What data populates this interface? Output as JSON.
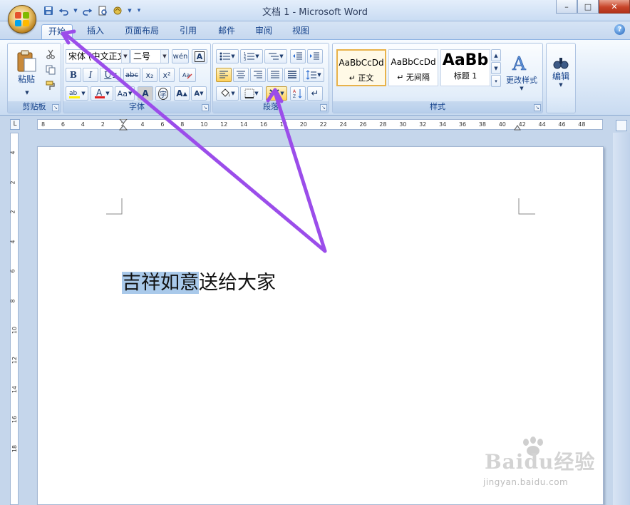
{
  "window": {
    "title": "文档 1 - Microsoft Word",
    "minimize": "–",
    "maximize": "□",
    "close": "✕"
  },
  "qat": {
    "save_icon": "save-icon",
    "undo_icon": "undo-icon",
    "redo_icon": "redo-icon",
    "print_preview_icon": "print-preview-icon",
    "customize_icon": "customize-qat-icon"
  },
  "tabs": [
    "开始",
    "插入",
    "页面布局",
    "引用",
    "邮件",
    "审阅",
    "视图"
  ],
  "active_tab": "开始",
  "help_label": "?",
  "ribbon": {
    "clipboard": {
      "label": "剪贴板",
      "paste": "粘贴"
    },
    "font": {
      "label": "字体",
      "font_name": "宋体 (中文正文)",
      "font_size": "二号",
      "bold": "B",
      "italic": "I",
      "underline": "U",
      "strike": "abc",
      "subscript": "x₂",
      "superscript": "x²",
      "change_case": "Aa",
      "char_shading": "A",
      "enclose": "字",
      "grow": "A",
      "wen": "wén",
      "border_a": "A"
    },
    "paragraph": {
      "label": "段落"
    },
    "styles": {
      "label": "样式",
      "items": [
        {
          "sample": "AaBbCcDd",
          "name": "↵ 正文"
        },
        {
          "sample": "AaBbCcDd",
          "name": "↵ 无间隔"
        },
        {
          "sample": "AaBb",
          "name": "标题 1"
        }
      ],
      "change_styles": "更改样式"
    },
    "editing": {
      "label": "编辑"
    }
  },
  "ruler": {
    "corner": "L",
    "h_ticks": [
      "8",
      "6",
      "4",
      "2",
      "2",
      "4",
      "6",
      "8",
      "10",
      "12",
      "14",
      "16",
      "18",
      "20",
      "22",
      "24",
      "26",
      "28",
      "30",
      "32",
      "34",
      "36",
      "38",
      "40",
      "42",
      "44",
      "46",
      "48"
    ],
    "v_ticks": [
      "4",
      "2",
      "2",
      "4",
      "6",
      "8",
      "10",
      "12",
      "14",
      "16",
      "18"
    ]
  },
  "document": {
    "selected_text": "吉祥如意",
    "rest_text": "送给大家"
  },
  "watermark": {
    "brand": "Baidu经验",
    "url": "jingyan.baidu.com"
  },
  "colors": {
    "annotation_arrow": "#9b4dea",
    "selection": "#a9c9ea"
  }
}
